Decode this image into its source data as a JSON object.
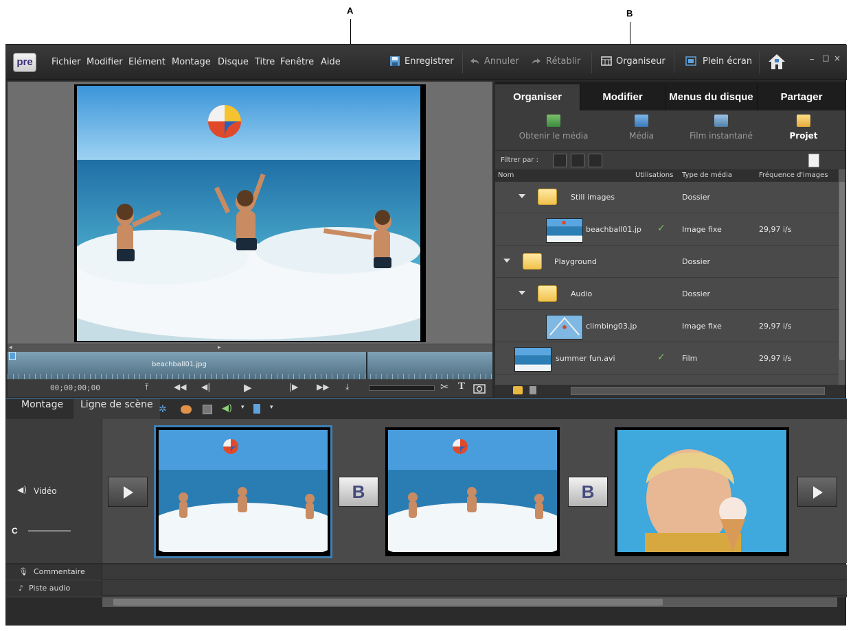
{
  "callouts": {
    "a": "A",
    "b": "B",
    "c": "C"
  },
  "menubar": {
    "logo": "pre",
    "menus": [
      "Fichier",
      "Modifier",
      "Elément",
      "Montage",
      "Disque",
      "Titre",
      "Fenêtre",
      "Aide"
    ],
    "save": "Enregistrer",
    "undo": "Annuler",
    "redo": "Rétablir",
    "organizer": "Organiseur",
    "fullscreen": "Plein écran"
  },
  "monitor": {
    "clip_name": "beachball01.jpg",
    "timecode": "00;00;00;00"
  },
  "tabs": [
    "Organiser",
    "Modifier",
    "Menus du disque",
    "Partager"
  ],
  "subtoolbar": {
    "get_media": "Obtenir le média",
    "media": "Média",
    "instant_movie": "Film instantané",
    "project": "Projet"
  },
  "filter_label": "Filtrer par :",
  "list_headers": {
    "name": "Nom",
    "uses": "Utilisations",
    "type": "Type de média",
    "fps": "Fréquence d'images"
  },
  "items": [
    {
      "name": "Still images",
      "type": "Dossier",
      "fps": ""
    },
    {
      "name": "beachball01.jp",
      "type": "Image fixe",
      "fps": "29,97 i/s"
    },
    {
      "name": "Playground",
      "type": "Dossier",
      "fps": ""
    },
    {
      "name": "Audio",
      "type": "Dossier",
      "fps": ""
    },
    {
      "name": "climbing03.jp",
      "type": "Image fixe",
      "fps": "29,97 i/s"
    },
    {
      "name": "summer fun.avi",
      "type": "Film",
      "fps": "29,97 i/s"
    }
  ],
  "storyboard": {
    "tab_montage": "Montage",
    "tab_scene": "Ligne de scène",
    "video_label": "Vidéo",
    "transition_label": "B",
    "comment_label": "Commentaire",
    "audio_label": "Piste audio"
  },
  "colors": {
    "accent": "#3f7fb4",
    "check": "#7dc553"
  }
}
